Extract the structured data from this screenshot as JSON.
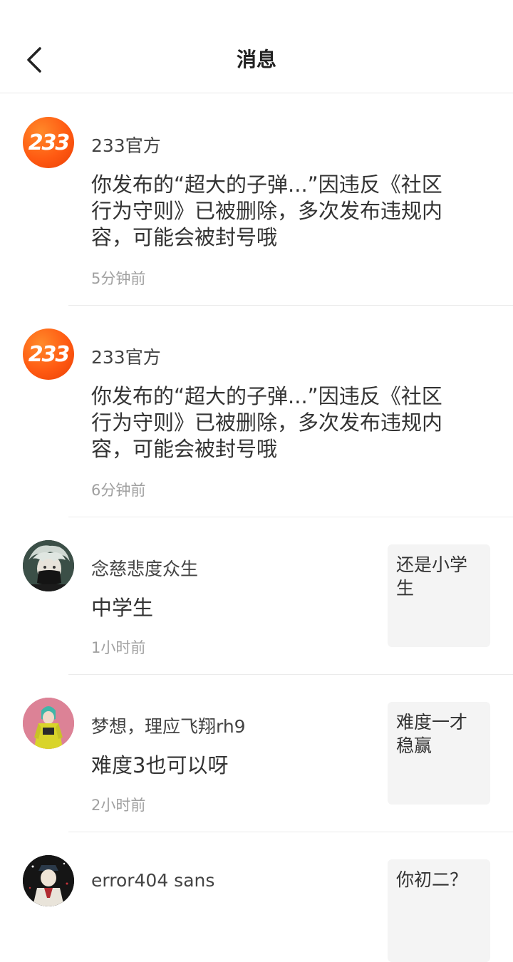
{
  "header": {
    "title": "消息",
    "back_icon": "chevron-left-icon"
  },
  "messages": [
    {
      "avatar_text": "233",
      "username": "233官方",
      "content": "你发布的“超大的子弹...”因违反《社区行为守则》已被删除，多次发布违规内容，可能会被封号哦",
      "time": "5分钟前"
    },
    {
      "avatar_text": "233",
      "username": "233官方",
      "content": "你发布的“超大的子弹...”因违反《社区行为守则》已被删除，多次发布违规内容，可能会被封号哦",
      "time": "6分钟前"
    },
    {
      "username": "念慈悲度众生",
      "content": "中学生",
      "time": "1小时前",
      "quote": "还是小学生"
    },
    {
      "username": "梦想，理应飞翔rh9",
      "content": "难度3也可以呀",
      "time": "2小时前",
      "quote": "难度一才稳赢"
    },
    {
      "username": "error404 sans",
      "quote": "你初二？"
    }
  ],
  "colors": {
    "official_avatar": "#ff5a12",
    "time_text": "#a0a0a0",
    "quote_bg": "#f4f4f4"
  }
}
